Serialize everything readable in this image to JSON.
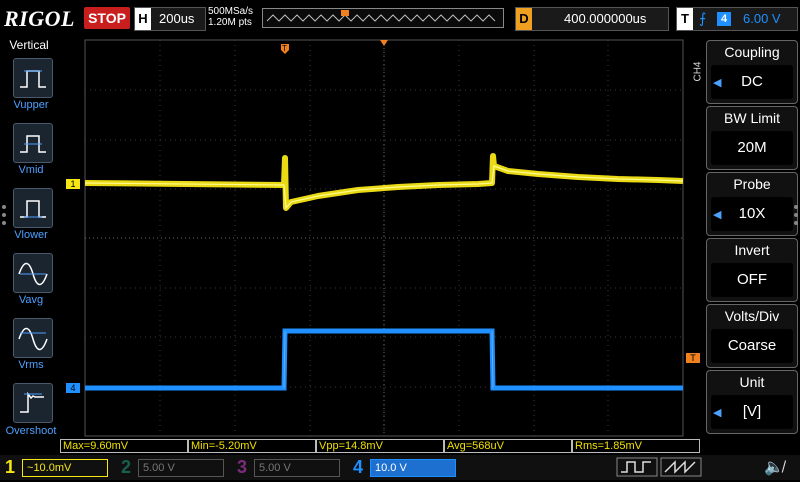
{
  "brand": "RIGOL",
  "run_state": "STOP",
  "horizontal": {
    "key": "H",
    "value": "200us"
  },
  "sample_rate": "500MSa/s",
  "memory_depth": "1.20M pts",
  "delay": {
    "key": "D",
    "value": "400.000000us"
  },
  "trigger": {
    "key": "T",
    "source": "4",
    "level": "6.00 V"
  },
  "left_menu": {
    "title": "Vertical",
    "items": [
      {
        "label": "Vupper"
      },
      {
        "label": "Vmid"
      },
      {
        "label": "Vlower"
      },
      {
        "label": "Vavg"
      },
      {
        "label": "Vrms"
      },
      {
        "label": "Overshoot"
      }
    ]
  },
  "right_menu": {
    "channel_tag": "CH4",
    "items": [
      {
        "title": "Coupling",
        "value": "DC"
      },
      {
        "title": "BW Limit",
        "value": "20M"
      },
      {
        "title": "Probe",
        "value": "10X"
      },
      {
        "title": "Invert",
        "value": "OFF"
      },
      {
        "title": "Volts/Div",
        "value": "Coarse"
      },
      {
        "title": "Unit",
        "value": "[V]"
      }
    ]
  },
  "markers": {
    "ch1": "1",
    "ch4": "4",
    "trigger_level": "T"
  },
  "measurements": [
    {
      "label": "Max=9.60mV"
    },
    {
      "label": "Min=-5.20mV"
    },
    {
      "label": "Vpp=14.8mV"
    },
    {
      "label": "Avg=568uV"
    },
    {
      "label": "Rms=1.85mV"
    }
  ],
  "channels": [
    {
      "num": "1",
      "value": "10.0mV",
      "coupling": "~",
      "color": "#f5e614"
    },
    {
      "num": "2",
      "value": "5.00 V",
      "coupling": "",
      "color": "#1fb08c"
    },
    {
      "num": "3",
      "value": "5.00 V",
      "coupling": "",
      "color": "#c040c0"
    },
    {
      "num": "4",
      "value": "10.0 V",
      "coupling": "",
      "color": "#1e90ff"
    }
  ],
  "colors": {
    "ch1": "#f5e614",
    "ch4": "#1e90ff",
    "trigger": "#f08020",
    "stop": "#c81e1e",
    "grid": "#3a3a3a"
  }
}
